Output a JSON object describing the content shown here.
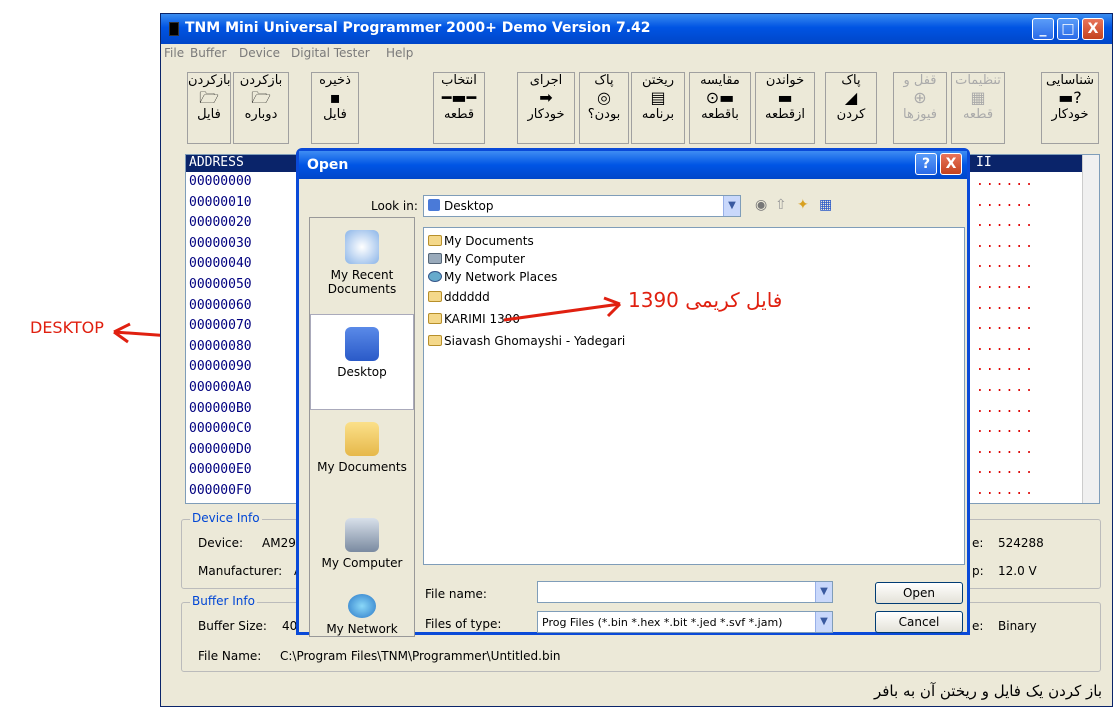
{
  "window": {
    "title": "TNM Mini Universal Programmer 2000+ Demo   Version 7.42",
    "controls": [
      "_",
      "□",
      "X"
    ]
  },
  "menu": [
    "File",
    "Buffer",
    "Device",
    "Digital Tester",
    "Help"
  ],
  "toolbar": [
    {
      "top": "بازکردن",
      "bottom": "فایل",
      "icon": "folder-icon"
    },
    {
      "top": "بازکردن",
      "bottom": "دوباره",
      "icon": "folder-icon"
    },
    {
      "top": "ذخیره",
      "bottom": "فایل",
      "icon": "floppy-icon"
    },
    {
      "top": "انتخاب",
      "bottom": "قطعه",
      "icon": "chip-icon"
    },
    {
      "top": "اجرای",
      "bottom": "خودکار",
      "icon": "arrow-icon"
    },
    {
      "top": "پاک",
      "bottom": "بودن؟",
      "icon": "check-icon"
    },
    {
      "top": "ریختن",
      "bottom": "برنامه",
      "icon": "write-icon"
    },
    {
      "top": "مقایسه",
      "bottom": "باقطعه",
      "icon": "compare-icon"
    },
    {
      "top": "خواندن",
      "bottom": "ازقطعه",
      "icon": "read-icon"
    },
    {
      "top": "پاک",
      "bottom": "کردن",
      "icon": "erase-icon"
    },
    {
      "top": "قفل و",
      "bottom": "فیوزها",
      "icon": "lock-icon"
    },
    {
      "top": "تنظیمات",
      "bottom": "قطعه",
      "icon": "settings-icon"
    },
    {
      "top": "شناسایی",
      "bottom": "خودکار",
      "icon": "chip-question-icon"
    }
  ],
  "hex": {
    "header_address": "ADDRESS",
    "header_ascii": "II",
    "addresses": [
      "00000000",
      "00000010",
      "00000020",
      "00000030",
      "00000040",
      "00000050",
      "00000060",
      "00000070",
      "00000080",
      "00000090",
      "000000A0",
      "000000B0",
      "000000C0",
      "000000D0",
      "000000E0",
      "000000F0"
    ],
    "dots": "......"
  },
  "device_info": {
    "title": "Device Info",
    "device_label": "Device:",
    "device_value": "AM29",
    "manufacturer_label": "Manufacturer:",
    "manufacturer_value": "A",
    "size_value": "524288",
    "voltage_value": "12.0 V",
    "size_suffix": "e:",
    "voltage_suffix": "p:"
  },
  "buffer_info": {
    "title": "Buffer Info",
    "size_label": "Buffer Size:",
    "size_value": "40",
    "type_value": "Binary",
    "type_suffix": "e:",
    "filename_label": "File Name:",
    "filename_value": "C:\\Program Files\\TNM\\Programmer\\Untitled.bin"
  },
  "dialog": {
    "title": "Open",
    "help_btn": "?",
    "close_btn": "X",
    "look_in_label": "Look in:",
    "look_in_value": "Desktop",
    "places": [
      "My Recent Documents",
      "Desktop",
      "My Documents",
      "My Computer",
      "My Network"
    ],
    "files": [
      "My Documents",
      "My Computer",
      "My Network Places",
      "dddddd",
      "KARIMI 1390",
      "Siavash Ghomayshi - Yadegari"
    ],
    "filename_label": "File name:",
    "filename_value": "",
    "filetype_label": "Files of type:",
    "filetype_value": "Prog Files (*.bin *.hex *.bit *.jed *.svf *.jam)",
    "open_btn": "Open",
    "cancel_btn": "Cancel"
  },
  "annotations": {
    "desktop": "DESKTOP",
    "file_note": "فایل کریمی 1390",
    "caption": "باز کردن یک فایل و ریختن آن به بافر"
  }
}
